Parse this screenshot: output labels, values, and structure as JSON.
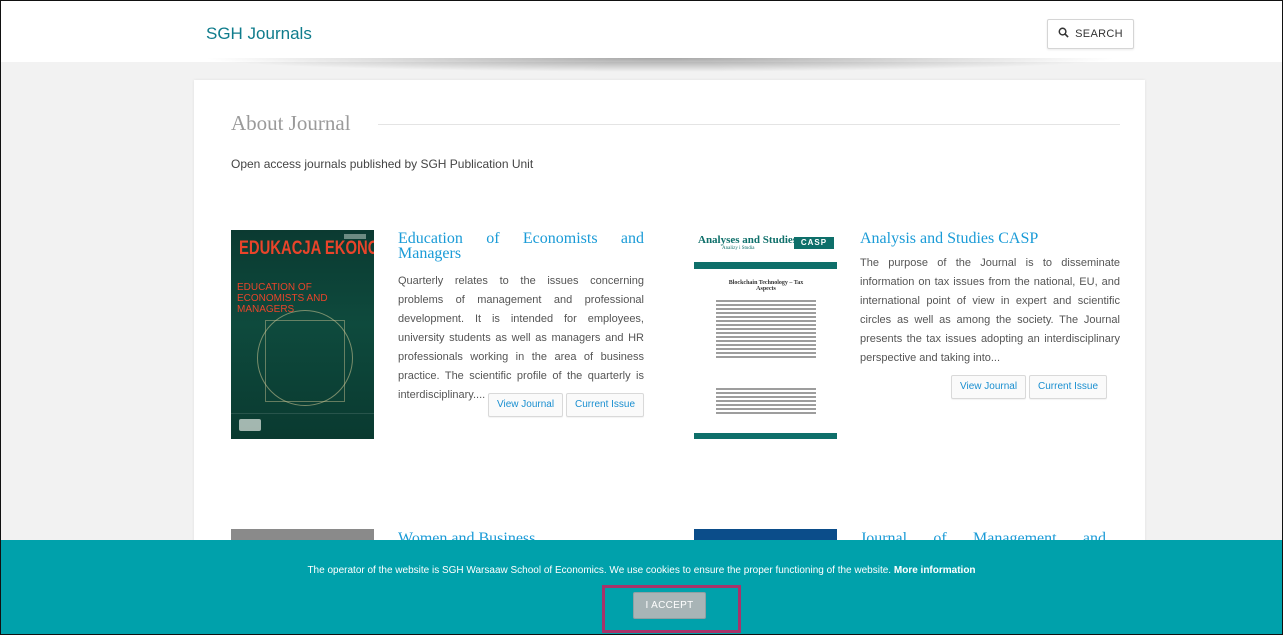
{
  "header": {
    "brand": "SGH Journals",
    "search_label": "SEARCH"
  },
  "about": {
    "title": "About Journal",
    "description": "Open access journals published by SGH Publication Unit"
  },
  "journals": [
    {
      "title": "Education of Economists and Managers",
      "description": "Quarterly relates to the issues concerning problems of management and professional development. It is intended for employees, university students as well as managers and HR professionals working in the area of business practice. The scientific profile of the quarterly is interdisciplinary....",
      "view_label": "View Journal",
      "issue_label": "Current Issue",
      "cover_title": "EDUKACJA EKONOMISTÓW I MENEDŻERÓW",
      "cover_subtitle": "EDUCATION OF ECONOMISTS AND MANAGERS"
    },
    {
      "title": "Analysis and Studies CASP",
      "description": "The purpose of the Journal is to disseminate information on tax issues from the national, EU, and international point of view in expert and scientific circles as well as among the society.  The Journal presents the tax issues adopting an interdisciplinary perspective and taking into...",
      "view_label": "View Journal",
      "issue_label": "Current Issue",
      "cover_header": "Analyses and Studies",
      "cover_header_sub": "Analizy i Studia",
      "cover_logo": "CASP",
      "cover_article": "Blockchain Technology – Tax Aspects"
    },
    {
      "title": "Women and Business"
    },
    {
      "title": "Journal of Management and"
    }
  ],
  "cookie_banner": {
    "text": "The operator of the website is SGH Warsaaw School of Economics. We use cookies to ensure the proper functioning of the website.",
    "more_info": "More information",
    "accept_label": "I ACCEPT"
  },
  "colors": {
    "brand": "#0f7c8c",
    "link": "#1a9bd7",
    "banner": "#00a1ab",
    "highlight": "#a8336a"
  }
}
